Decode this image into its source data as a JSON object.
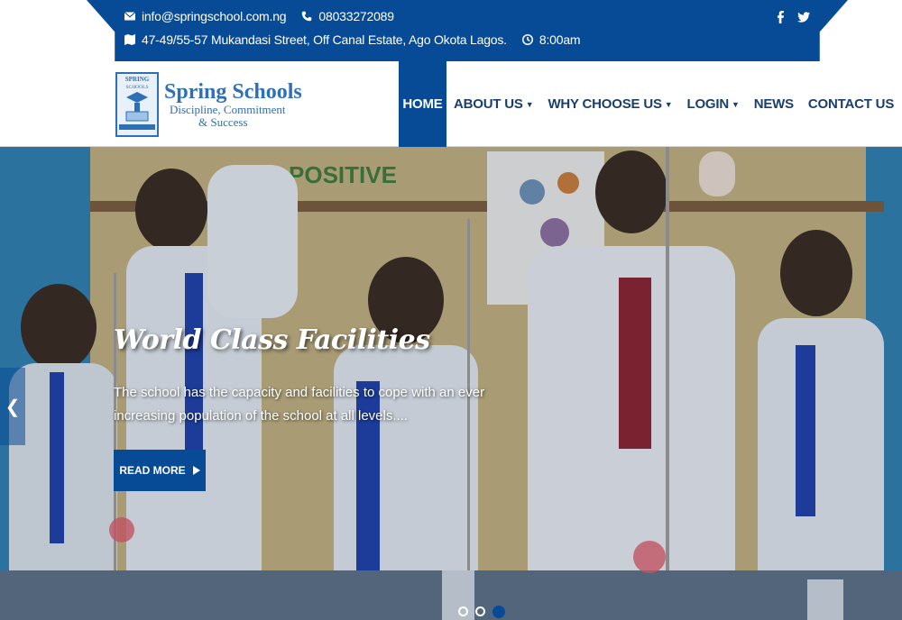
{
  "topbar": {
    "email": "info@springschool.com.ng",
    "phone": "08033272089",
    "address": "47-49/55-57 Mukandasi Street, Off Canal Estate, Ago Okota Lagos.",
    "hours": "8:00am",
    "icons": [
      "envelope-icon",
      "phone-icon",
      "map-icon",
      "clock-icon",
      "facebook-icon",
      "twitter-icon"
    ]
  },
  "logo": {
    "name": "Spring Schools",
    "tagline1": "Discipline, Commitment",
    "tagline2": "& Success",
    "crest_text": "SPRING SCHOOLS"
  },
  "nav": {
    "items": [
      {
        "label": "HOME",
        "active": true,
        "dropdown": false
      },
      {
        "label": "ABOUT US",
        "active": false,
        "dropdown": true
      },
      {
        "label": "WHY CHOOSE US",
        "active": false,
        "dropdown": true
      },
      {
        "label": "LOGIN",
        "active": false,
        "dropdown": true
      },
      {
        "label": "NEWS",
        "active": false,
        "dropdown": false
      },
      {
        "label": "CONTACT US",
        "active": false,
        "dropdown": false
      }
    ]
  },
  "hero": {
    "title": "World Class Facilities",
    "text": "The school has the capacity and facilities to cope with an ever increasing population of the school at all levels....",
    "button": "READ MORE",
    "slides": 3,
    "active_slide": 3,
    "wall_sign": "POSITIVE"
  },
  "colors": {
    "primary": "#074b97",
    "nav_text": "#1a3f6e",
    "logo_blue": "#2e6fb6"
  }
}
